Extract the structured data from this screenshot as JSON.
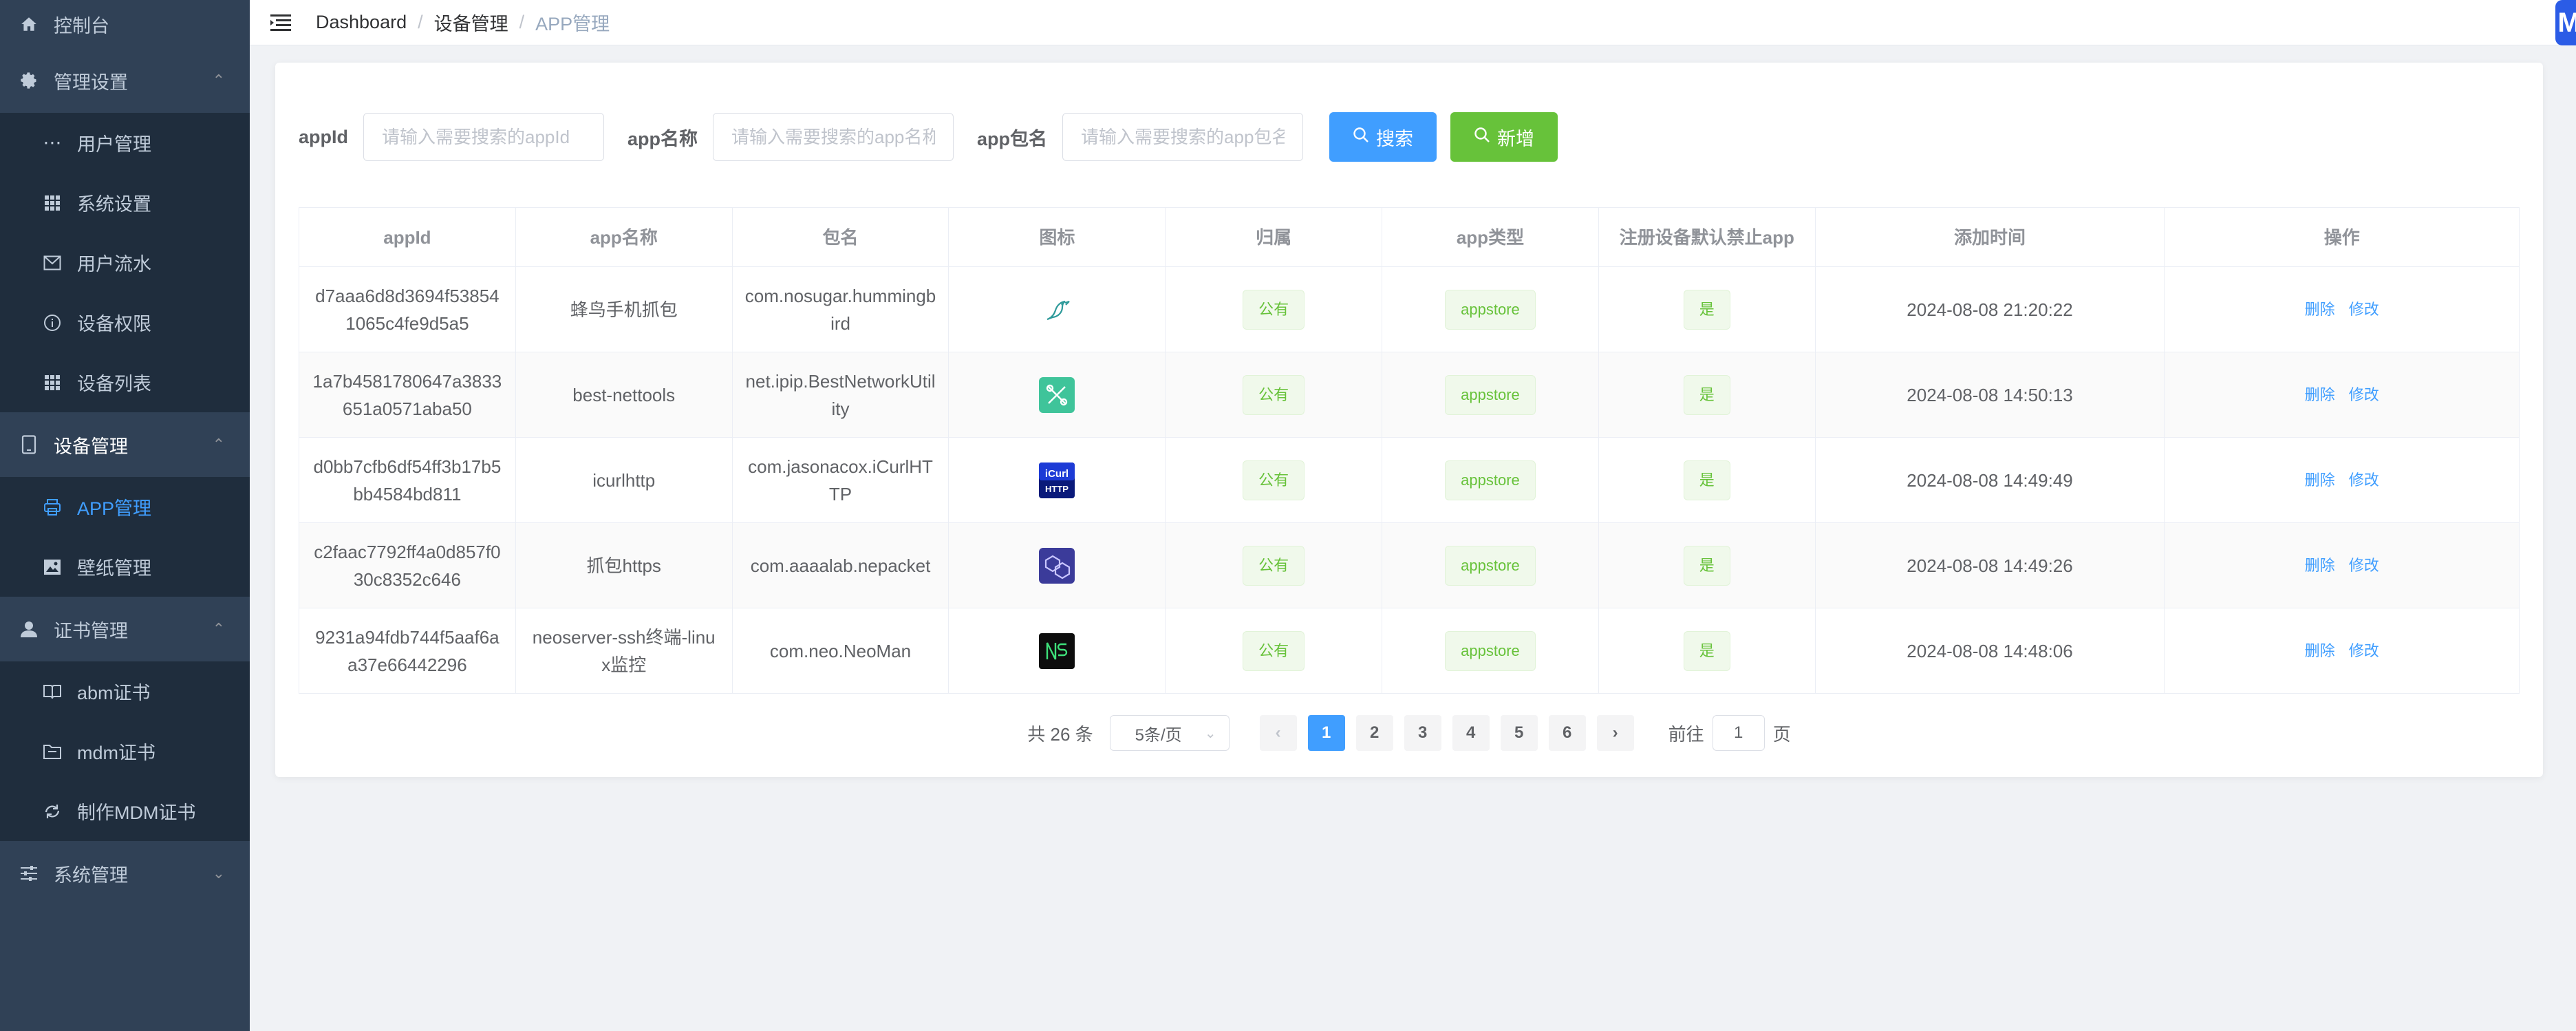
{
  "sidebar": {
    "items": [
      {
        "label": "控制台",
        "icon": "home-icon"
      },
      {
        "label": "管理设置",
        "icon": "gear-icon",
        "arrow": "^"
      },
      {
        "label": "用户管理",
        "icon": "dots-icon"
      },
      {
        "label": "系统设置",
        "icon": "grid-icon"
      },
      {
        "label": "用户流水",
        "icon": "mail-icon"
      },
      {
        "label": "设备权限",
        "icon": "info-icon"
      },
      {
        "label": "设备列表",
        "icon": "grid-icon"
      },
      {
        "label": "设备管理",
        "icon": "phone-icon",
        "arrow": "^"
      },
      {
        "label": "APP管理",
        "icon": "printer-icon"
      },
      {
        "label": "壁纸管理",
        "icon": "picture-icon"
      },
      {
        "label": "证书管理",
        "icon": "user-icon",
        "arrow": "^"
      },
      {
        "label": "abm证书",
        "icon": "book-icon"
      },
      {
        "label": "mdm证书",
        "icon": "folder-icon"
      },
      {
        "label": "制作MDM证书",
        "icon": "refresh-icon"
      },
      {
        "label": "系统管理",
        "icon": "sliders-icon",
        "arrow": "v"
      }
    ]
  },
  "navbar": {
    "breadcrumb": [
      "Dashboard",
      "/",
      "设备管理",
      "/",
      "APP管理"
    ],
    "corner_badge": "M"
  },
  "search": {
    "appid_label": "appId",
    "appid_placeholder": "请输入需要搜索的appId",
    "name_label": "app名称",
    "name_placeholder": "请输入需要搜索的app名称",
    "package_label": "app包名",
    "package_placeholder": "请输入需要搜索的app包名",
    "search_button": "搜索",
    "add_button": "新增"
  },
  "table": {
    "columns": [
      "appId",
      "app名称",
      "包名",
      "图标",
      "归属",
      "app类型",
      "注册设备默认禁止app",
      "添加时间",
      "操作"
    ],
    "rows": [
      {
        "appId": "d7aaa6d8d3694f538541065c4fe9d5a5",
        "name": "蜂鸟手机抓包",
        "package": "com.nosugar.hummingbird",
        "icon": "hummingbird-icon",
        "owner": "公有",
        "type": "appstore",
        "forbid": "是",
        "time": "2024-08-08 21:20:22",
        "del": "删除",
        "edit": "修改"
      },
      {
        "appId": "1a7b4581780647a3833651a0571aba50",
        "name": "best-nettools",
        "package": "net.ipip.BestNetworkUtility",
        "icon": "nettools-icon",
        "owner": "公有",
        "type": "appstore",
        "forbid": "是",
        "time": "2024-08-08 14:50:13",
        "del": "删除",
        "edit": "修改"
      },
      {
        "appId": "d0bb7cfb6df54ff3b17b5bb4584bd811",
        "name": "icurlhttp",
        "package": "com.jasonacox.iCurlHTTP",
        "icon": "icurl-icon",
        "owner": "公有",
        "type": "appstore",
        "forbid": "是",
        "time": "2024-08-08 14:49:49",
        "del": "删除",
        "edit": "修改"
      },
      {
        "appId": "c2faac7792ff4a0d857f030c8352c646",
        "name": "抓包https",
        "package": "com.aaaalab.nepacket",
        "icon": "nepacket-icon",
        "owner": "公有",
        "type": "appstore",
        "forbid": "是",
        "time": "2024-08-08 14:49:26",
        "del": "删除",
        "edit": "修改"
      },
      {
        "appId": "9231a94fdb744f5aaf6aa37e66442296",
        "name": "neoserver-ssh终端-linux监控",
        "package": "com.neo.NeoMan",
        "icon": "neoserver-icon",
        "owner": "公有",
        "type": "appstore",
        "forbid": "是",
        "time": "2024-08-08 14:48:06",
        "del": "删除",
        "edit": "修改"
      }
    ]
  },
  "pagination": {
    "total_text": "共 26 条",
    "page_size": "5条/页",
    "pages": [
      "1",
      "2",
      "3",
      "4",
      "5",
      "6"
    ],
    "current": "1",
    "goto_label": "前往",
    "goto_value": "1",
    "goto_suffix": "页"
  },
  "colors": {
    "sidebar_bg": "#304156",
    "submenu_bg": "#1f2d3d",
    "accent": "#409eff",
    "success": "#67c23a"
  }
}
